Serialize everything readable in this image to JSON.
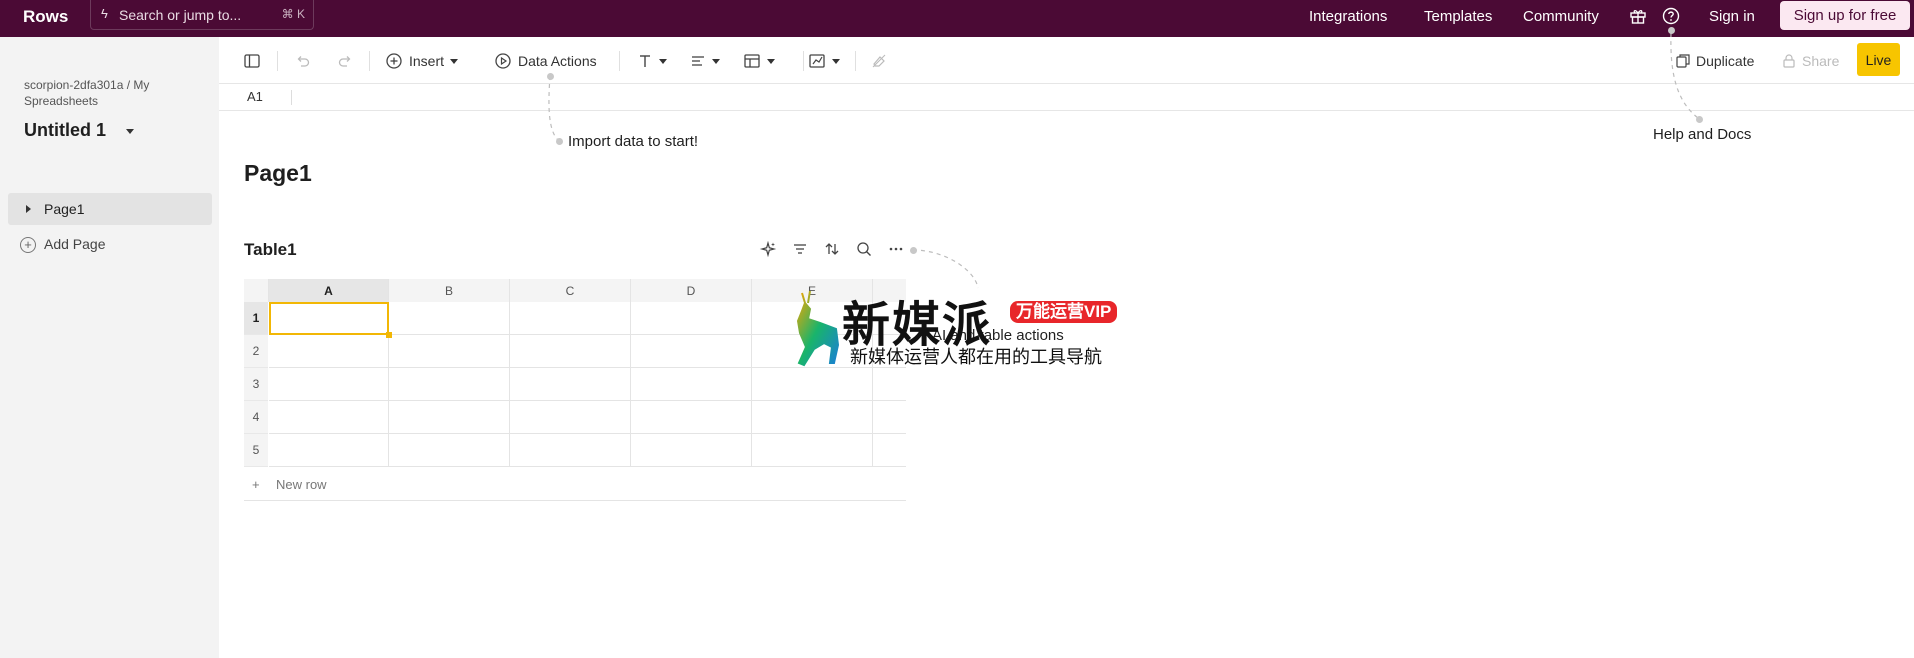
{
  "topbar": {
    "logo": "Rows",
    "search_placeholder": "Search or jump to...",
    "search_shortcut": "⌘ K",
    "nav": [
      "Integrations",
      "Templates",
      "Community"
    ],
    "sign_in": "Sign in",
    "sign_up": "Sign up for free"
  },
  "sidebar": {
    "breadcrumb": "scorpion-2dfa301a / My Spreadsheets",
    "doc_title": "Untitled 1",
    "pages": [
      {
        "label": "Page1"
      }
    ],
    "add_page": "Add Page"
  },
  "toolbar": {
    "insert": "Insert",
    "data_actions": "Data Actions",
    "duplicate": "Duplicate",
    "share": "Share",
    "live": "Live"
  },
  "formula_bar": {
    "cell_ref": "A1"
  },
  "hints": {
    "import": "Import data to start!",
    "help": "Help and Docs",
    "table_actions": "AI and table actions"
  },
  "page": {
    "title": "Page1"
  },
  "table": {
    "title": "Table1",
    "columns": [
      "A",
      "B",
      "C",
      "D",
      "E"
    ],
    "rows": [
      "1",
      "2",
      "3",
      "4",
      "5"
    ],
    "new_row_plus": "+",
    "new_row": "New row",
    "active_cell": "A1"
  },
  "watermark": {
    "title": "新媒派",
    "tag": "万能运营VIP",
    "subtitle": "新媒体运营人都在用的工具导航"
  },
  "colors": {
    "topbar": "#4b0a35",
    "accent": "#f7c500",
    "signup_bg": "#fbe8f1"
  }
}
